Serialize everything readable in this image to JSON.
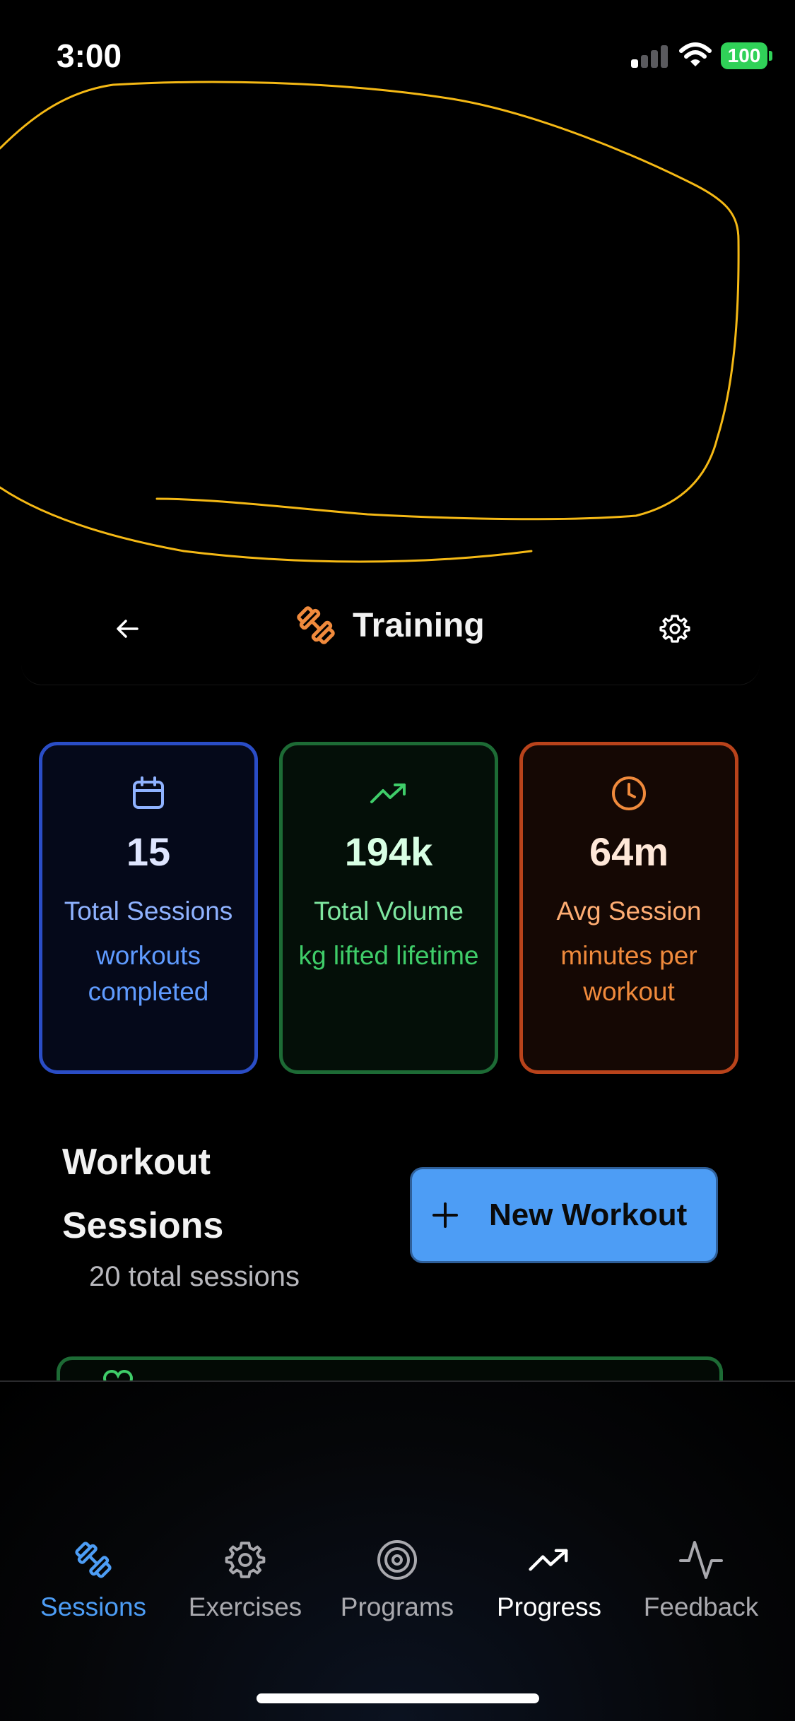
{
  "status_bar": {
    "time": "3:00",
    "battery": "100"
  },
  "header": {
    "title": "Training"
  },
  "stats": [
    {
      "value": "15",
      "label": "Total Sessions",
      "sub": "workouts completed",
      "icon": "calendar-icon"
    },
    {
      "value": "194k",
      "label": "Total Volume",
      "sub": "kg lifted lifetime",
      "icon": "trending-up-icon"
    },
    {
      "value": "64m",
      "label": "Avg Session",
      "sub": "minutes per workout",
      "icon": "clock-icon"
    }
  ],
  "sessions": {
    "title": "Workout Sessions",
    "subtitle": "20 total sessions",
    "new_button": "New Workout"
  },
  "tabs": [
    {
      "label": "Sessions",
      "icon": "dumbbell-icon",
      "active": true
    },
    {
      "label": "Exercises",
      "icon": "gear-icon"
    },
    {
      "label": "Programs",
      "icon": "target-icon"
    },
    {
      "label": "Progress",
      "icon": "trending-up-icon"
    },
    {
      "label": "Feedback",
      "icon": "activity-icon"
    }
  ],
  "colors": {
    "accent_blue": "#4d9df5",
    "green": "#3fcd69",
    "orange": "#f08a3c",
    "annotation": "#f5b915"
  }
}
